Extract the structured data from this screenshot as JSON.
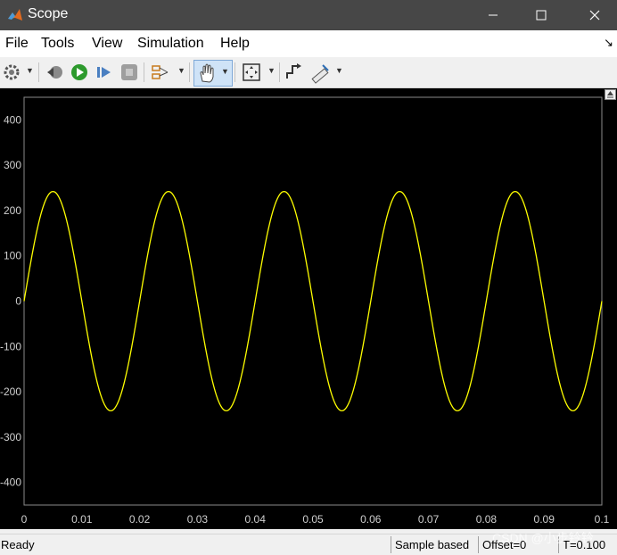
{
  "window": {
    "title": "Scope"
  },
  "menu": {
    "items": [
      "File",
      "Tools",
      "View",
      "Simulation",
      "Help"
    ]
  },
  "chart_data": {
    "type": "line",
    "xlim": [
      0,
      0.1
    ],
    "ylim": [
      -450,
      450
    ],
    "x_ticks": [
      "0",
      "0.01",
      "0.02",
      "0.03",
      "0.04",
      "0.05",
      "0.06",
      "0.07",
      "0.08",
      "0.09",
      "0.1"
    ],
    "y_ticks": [
      "400",
      "300",
      "200",
      "100",
      "0",
      "-100",
      "-200",
      "-300",
      "-400"
    ],
    "series": [
      {
        "color": "#ffff00",
        "function": "sine",
        "amplitude": 242,
        "frequency_hz": 50,
        "phase": 0,
        "x_start": 0,
        "x_end": 0.1
      }
    ],
    "grid": true,
    "background": "#000000",
    "grid_color": "#5a5a5a"
  },
  "status": {
    "ready": "Ready",
    "sample_based": "Sample based",
    "offset": "Offset=0",
    "time": "T=0.100"
  },
  "watermark": "CSDN @小步铃铃"
}
